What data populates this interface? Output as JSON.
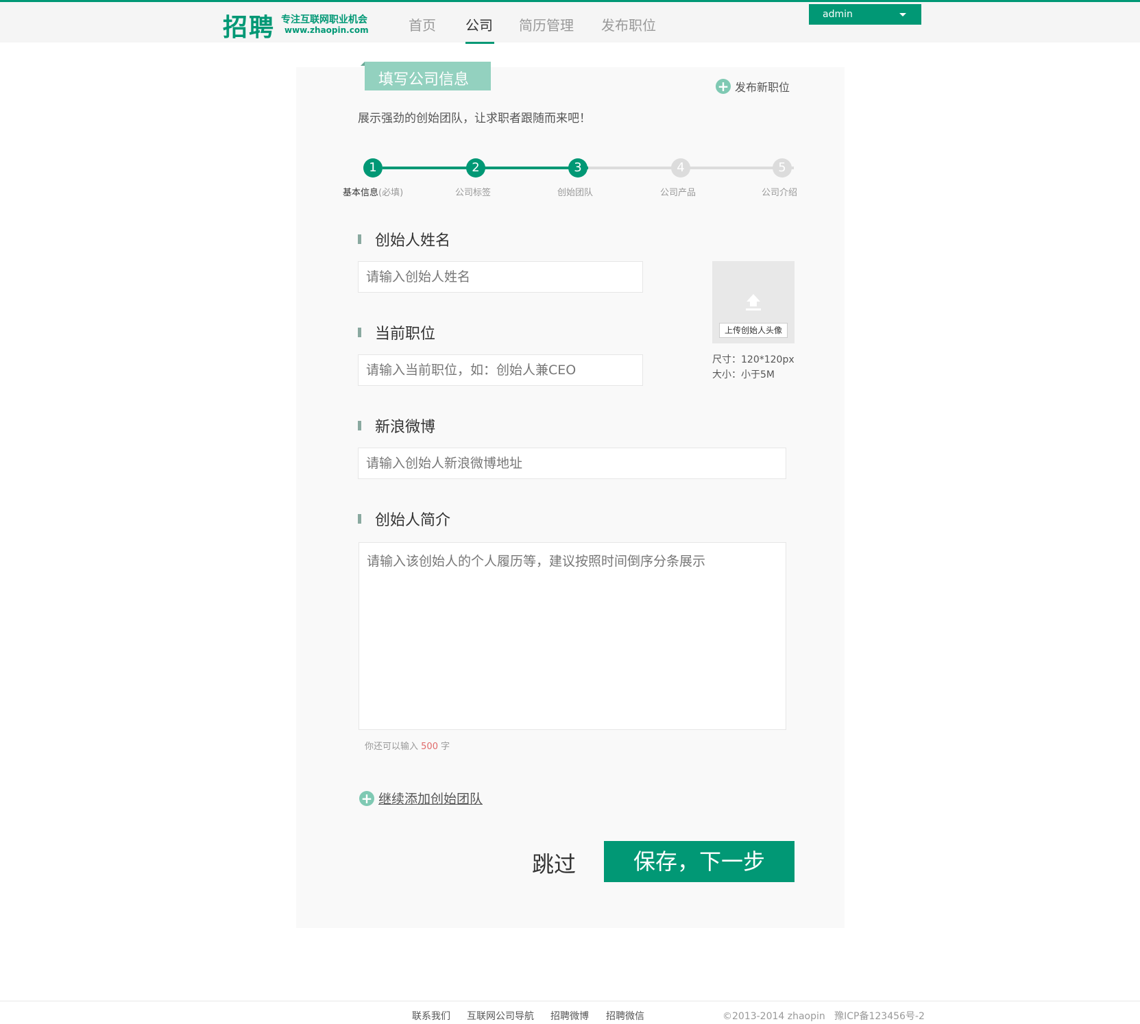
{
  "header": {
    "logo_main": "招聘",
    "logo_slogan": "专注互联网职业机会",
    "logo_url": "www.zhaopin.com",
    "nav": [
      {
        "label": "首页"
      },
      {
        "label": "公司"
      },
      {
        "label": "简历管理"
      },
      {
        "label": "发布职位"
      }
    ],
    "user": "admin"
  },
  "card": {
    "tab_title": "填写公司信息",
    "publish_label": "发布新职位",
    "subtitle": "展示强劲的创始团队，让求职者跟随而来吧！"
  },
  "steps": {
    "items": [
      {
        "num": "1",
        "label": "基本信息",
        "note": "(必填)"
      },
      {
        "num": "2",
        "label": "公司标签"
      },
      {
        "num": "3",
        "label": "创始团队"
      },
      {
        "num": "4",
        "label": "公司产品"
      },
      {
        "num": "5",
        "label": "公司介绍"
      }
    ],
    "active_step": 3
  },
  "form": {
    "name_label": "创始人姓名",
    "name_placeholder": "请输入创始人姓名",
    "position_label": "当前职位",
    "position_placeholder": "请输入当前职位，如：创始人兼CEO",
    "weibo_label": "新浪微博",
    "weibo_placeholder": "请输入创始人新浪微博地址",
    "intro_label": "创始人简介",
    "intro_placeholder": "请输入该创始人的个人履历等，建议按照时间倒序分条展示",
    "count_prefix": "你还可以输入",
    "count_num": "500",
    "count_suffix": "字",
    "upload_button": "上传创始人头像",
    "upload_size": "尺寸：120*120px",
    "upload_filesize": "大小：小于5M",
    "add_team": "继续添加创始团队",
    "skip": "跳过",
    "save": "保存，下一步"
  },
  "footer": {
    "links": [
      "联系我们",
      "互联网公司导航",
      "招聘微博",
      "招聘微信"
    ],
    "copyright": "©2013-2014 zhaopin",
    "icp": "豫ICP备123456号-2"
  },
  "colors": {
    "brand": "#019875",
    "tab": "#93d1bf",
    "step_todo": "#dcdcdc",
    "count_highlight": "#e06a6a"
  }
}
